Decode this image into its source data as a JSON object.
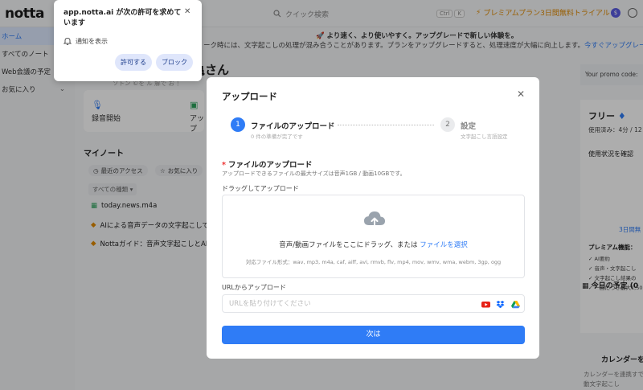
{
  "app": {
    "logo": "notta"
  },
  "topbar": {
    "search_placeholder": "クイック検索",
    "shortcut_ctrl": "Ctrl",
    "shortcut_k": "K",
    "premium_banner": "プレミアムプラン3日間無料トライアル"
  },
  "sidebar": {
    "items": [
      {
        "label": "ホーム"
      },
      {
        "label": "すべてのノート"
      },
      {
        "label": "Web会議の予定"
      },
      {
        "label": "お気に入り"
      }
    ]
  },
  "announcement": {
    "line1": "より速く、より使いやすく。アップグレードで新しい体験を。",
    "line2": "ーク時には、文字起こしの処理が混み合うことがあります。プランをアップグレードすると、処理速度が大幅に向上します。",
    "link": "今すぐアップグレード"
  },
  "home": {
    "greeting": "亀さん",
    "greeting_sub": "ソトン  ©を    ル 解で お ！",
    "record_label": "録音開始",
    "upload_label": "アップ",
    "mynotes_title": "マイノート",
    "filter_recent": "最近のアクセス",
    "filter_favorites": "お気に入り",
    "filter_kinds": "すべての種類",
    "notes": [
      {
        "title": "today.news.m4a"
      },
      {
        "title": "AIによる音声データの文字起こしで"
      },
      {
        "title": "Nottaガイド：音声文字起こしとAI要"
      }
    ]
  },
  "right_panel": {
    "promo_label": "Your promo code:",
    "plan_title": "フリー",
    "usage": "使用済み：4分 / 12",
    "usage_check": "使用状況を確認",
    "trial_link": "3日間無",
    "features_title": "プレミアム機能：",
    "features": [
      "AI要約",
      "音声・文字起こし",
      "文字起こし結果の",
      "一回につき最大1,50"
    ],
    "today_title": "今日の予定 (0",
    "calendar_title": "カレンダーを",
    "calendar_desc": "カレンダーを連携すで自動文字起こし"
  },
  "modal": {
    "title": "アップロード",
    "step1_num": "1",
    "step1_label": "ファイルのアップロード",
    "step1_sub": "0 件の準備が完了です",
    "step2_num": "2",
    "step2_label": "設定",
    "step2_sub": "文字起こし言語設定",
    "section_title": "ファイルのアップロード",
    "section_required": "*",
    "section_desc": "アップロードできるファイルの最大サイズは音声1GB / 動画10GBです。",
    "drag_label": "ドラッグしてアップロード",
    "drop_text": "音声/動画ファイルをここにドラッグ、または",
    "drop_link": "ファイルを選択",
    "formats": "対応ファイル形式：wav, mp3, m4a, caf, aiff, avi, rmvb, flv, mp4, mov, wmv, wma, webm, 3gp, ogg",
    "url_label": "URLからアップロード",
    "url_placeholder": "URLを貼り付けてください",
    "url_value": "",
    "next_label": "次は"
  },
  "permission": {
    "title": "app.notta.ai が次の許可を求めています",
    "notification": "通知を表示",
    "allow": "許可する",
    "block": "ブロック"
  },
  "colors": {
    "accent": "#2f7cf6",
    "premium": "#e08a00",
    "overlay": "rgba(0,0,0,0.32)"
  }
}
